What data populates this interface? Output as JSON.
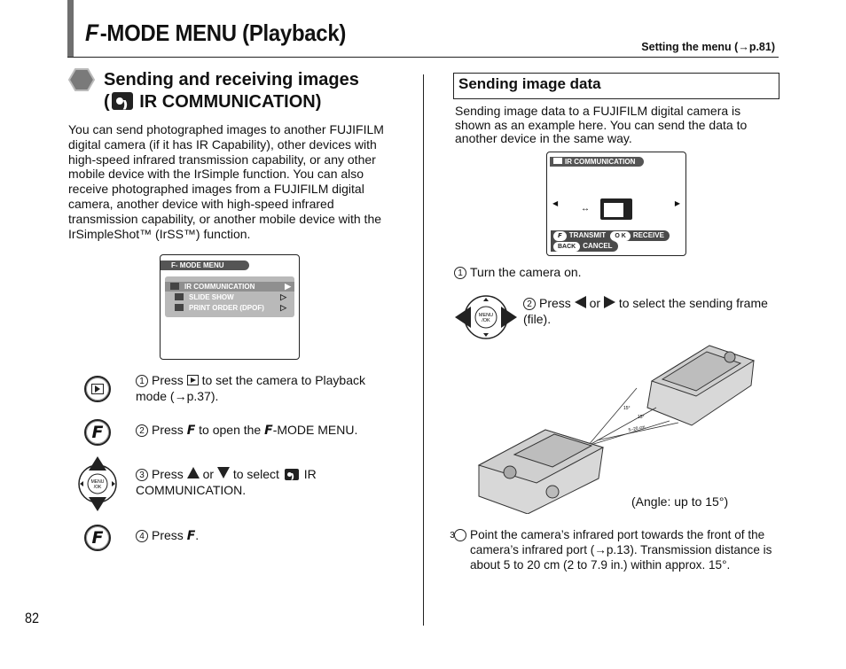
{
  "header": {
    "title_glyph": "F",
    "title": "-MODE MENU (Playback)",
    "reference": "Setting the menu (→p.81)"
  },
  "left": {
    "section_title_line1": "Sending and receiving images",
    "section_title_line2_open": "(",
    "section_title_line2": "IR COMMUNICATION)",
    "intro": "You can send photographed images to another FUJIFILM digital camera (if it has IR Capability), other devices with high-speed infrared transmission capability, or any other mobile device with the IrSimple function. You can also receive photographed images from a FUJIFILM digital camera, another device with high-speed infrared transmission capability, or another mobile device with the IrSimpleShot™ (IrSS™) function.",
    "lcd_menu": {
      "header": "F- MODE MENU",
      "items": [
        {
          "label": "IR COMMUNICATION",
          "selected": true
        },
        {
          "label": "SLIDE SHOW",
          "selected": false
        },
        {
          "label": "PRINT ORDER (DPOF)",
          "selected": false
        }
      ]
    },
    "steps": [
      {
        "num": "1",
        "pre": "Press",
        "post": "to set the camera to Playback mode (→p.37).",
        "button": "playback-button"
      },
      {
        "num": "2",
        "pre": "Press",
        "mid": "to open the",
        "post": "-MODE MENU.",
        "button": "f-button"
      },
      {
        "num": "3",
        "pre": "Press",
        "or": "or",
        "mid": "to select",
        "post": "IR COMMUNICATION.",
        "button": "menu-ok-dpad"
      },
      {
        "num": "4",
        "pre": "Press",
        "post": ".",
        "button": "f-button"
      }
    ]
  },
  "right": {
    "subsection_title": "Sending image data",
    "intro": "Sending image data to a FUJIFILM digital camera is shown as an example here. You can send the data to another device in the same way.",
    "lcd_ir": {
      "header": "IR COMMUNICATION",
      "transmit_key": "F",
      "transmit_label": "TRANSMIT",
      "receive_key": "O K",
      "receive_label": "RECEIVE",
      "cancel_key": "BACK",
      "cancel_label": "CANCEL"
    },
    "steps": [
      {
        "num": "1",
        "text": "Turn the camera on."
      },
      {
        "num": "2",
        "pre": "Press",
        "or": "or",
        "post": "to select the sending frame (file)."
      },
      {
        "num": "3",
        "text": "Point the camera’s infrared port towards the front of the camera’s infrared port (→p.13). Transmission distance is about 5 to 20 cm (2 to 7.9 in.) within approx. 15°."
      }
    ],
    "dpad_label": "MENU/OK",
    "illustration": {
      "angle_label_1": "15°",
      "angle_label_2": "15°",
      "distance_label": "5–20 cm",
      "caption": "(Angle: up to 15°)"
    }
  },
  "page_number": "82"
}
